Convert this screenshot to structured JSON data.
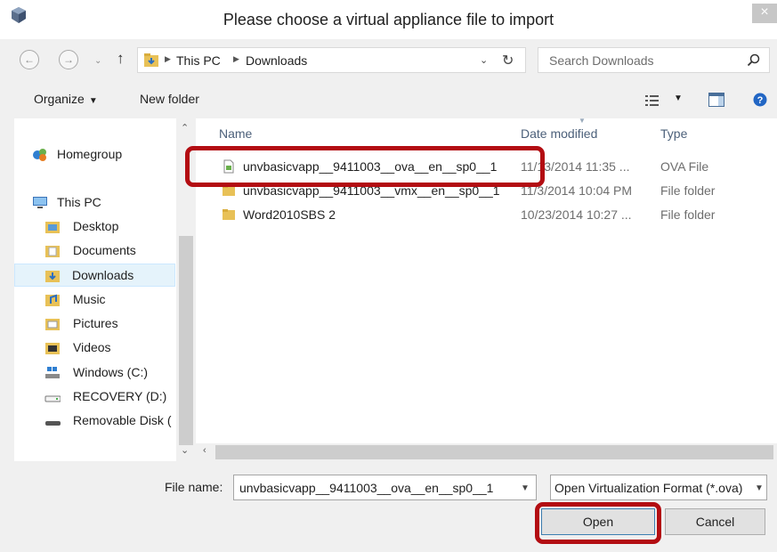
{
  "window": {
    "title": "Please choose a virtual appliance file to import",
    "close_glyph": "×"
  },
  "navigation": {
    "back_icon": "back-arrow-icon",
    "forward_icon": "forward-arrow-icon",
    "recent_icon": "recent-locations-chevron-icon",
    "up_icon": "up-arrow-icon",
    "breadcrumb": [
      "This PC",
      "Downloads"
    ]
  },
  "search": {
    "placeholder": "Search Downloads"
  },
  "toolbar": {
    "organize_label": "Organize",
    "new_folder_label": "New folder"
  },
  "sidebar": {
    "items": [
      {
        "label": "Homegroup",
        "icon": "homegroup-icon"
      },
      {
        "label": "This PC",
        "icon": "computer-icon"
      },
      {
        "label": "Desktop",
        "icon": "folder-icon"
      },
      {
        "label": "Documents",
        "icon": "folder-icon"
      },
      {
        "label": "Downloads",
        "icon": "downloads-folder-icon",
        "selected": true
      },
      {
        "label": "Music",
        "icon": "music-folder-icon"
      },
      {
        "label": "Pictures",
        "icon": "pictures-folder-icon"
      },
      {
        "label": "Videos",
        "icon": "videos-folder-icon"
      },
      {
        "label": "Windows (C:)",
        "icon": "system-drive-icon"
      },
      {
        "label": "RECOVERY (D:)",
        "icon": "drive-icon"
      },
      {
        "label": "Removable Disk (",
        "icon": "removable-disk-icon"
      }
    ]
  },
  "file_list": {
    "columns": [
      "Name",
      "Date modified",
      "Type"
    ],
    "rows": [
      {
        "name": "unvbasicvapp__9411003__ova__en__sp0__1",
        "date": "11/13/2014 11:35 ...",
        "type": "OVA File",
        "icon": "ova-file-icon"
      },
      {
        "name": "unvbasicvapp__9411003__vmx__en__sp0__1",
        "date": "11/3/2014 10:04 PM",
        "type": "File folder",
        "icon": "folder-icon"
      },
      {
        "name": "Word2010SBS 2",
        "date": "10/23/2014 10:27 ...",
        "type": "File folder",
        "icon": "folder-icon"
      }
    ]
  },
  "footer": {
    "file_name_label": "File name:",
    "file_name_value": "unvbasicvapp__9411003__ova__en__sp0__1",
    "filter_value": "Open Virtualization Format (*.ova)",
    "open_label": "Open",
    "cancel_label": "Cancel"
  },
  "colors": {
    "annotation": "#b30d12",
    "selection_fill": "#e5f3fb",
    "folder": "#e8c157"
  }
}
